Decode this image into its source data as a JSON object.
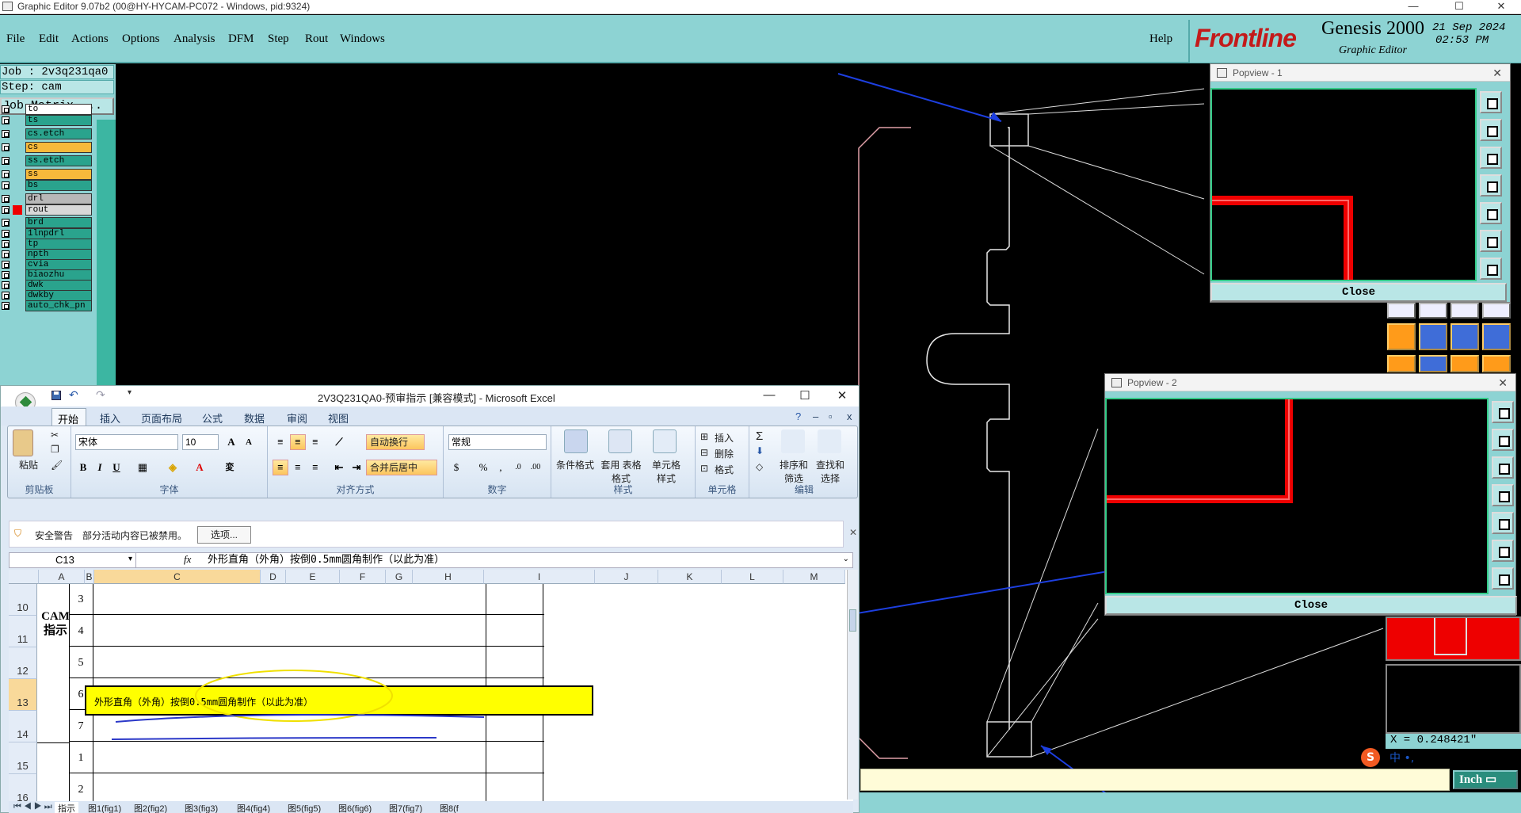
{
  "genesis": {
    "window_title": "Graphic Editor 9.07b2 (00@HY-HYCAM-PC072 - Windows, pid:9324)",
    "window_controls": [
      "—",
      "☐",
      "✕"
    ],
    "menu": [
      {
        "label": "File"
      },
      {
        "label": "Edit"
      },
      {
        "label": "Actions"
      },
      {
        "label": "Options"
      },
      {
        "label": "Analysis"
      },
      {
        "label": "DFM"
      },
      {
        "label": "Step"
      },
      {
        "label": "Rout"
      },
      {
        "label": "Windows"
      }
    ],
    "help_label": "Help",
    "brand": "Frontline",
    "product": "Genesis 2000",
    "subtitle": "Graphic Editor",
    "date": "21 Sep 2024",
    "time": "02:53 PM",
    "job": "Job : 2v3q231qa0",
    "step": "Step: cam",
    "job_matrix": "Job Matrix ...",
    "layers": [
      {
        "name": "to",
        "color": "#ffffff"
      },
      {
        "name": "ts",
        "color": "#2aa38d"
      },
      {
        "name": "cs.etch",
        "color": "#2aa38d"
      },
      {
        "name": "cs",
        "color": "#f6b93b"
      },
      {
        "name": "ss.etch",
        "color": "#2aa38d"
      },
      {
        "name": "ss",
        "color": "#f6b93b"
      },
      {
        "name": "bs",
        "color": "#2aa38d"
      },
      {
        "name": "drl",
        "color": "#b8b8b8"
      },
      {
        "name": "rout",
        "color": "#d8d8d8"
      },
      {
        "name": "brd",
        "color": "#2aa38d"
      },
      {
        "name": "1lnpdrl",
        "color": "#2aa38d"
      },
      {
        "name": "tp",
        "color": "#2aa38d"
      },
      {
        "name": "npth",
        "color": "#2aa38d"
      },
      {
        "name": "cvia",
        "color": "#2aa38d"
      },
      {
        "name": "biaozhu",
        "color": "#2aa38d"
      },
      {
        "name": "dwk",
        "color": "#2aa38d"
      },
      {
        "name": "dwkby",
        "color": "#2aa38d"
      },
      {
        "name": "auto_chk_pn",
        "color": "#2aa38d"
      }
    ],
    "popview1": {
      "title": "Popview - 1",
      "close": "Close"
    },
    "popview2": {
      "title": "Popview - 2",
      "close": "Close"
    },
    "coord_readout": "X = 0.248421\"",
    "units": "Inch",
    "ime_label": "中 •,"
  },
  "excel": {
    "title": "2V3Q231QA0-预审指示 [兼容模式] - Microsoft Excel",
    "tabs": [
      "开始",
      "插入",
      "页面布局",
      "公式",
      "数据",
      "审阅",
      "视图"
    ],
    "ribbon": {
      "paste": "粘贴",
      "clipboard_group": "剪贴板",
      "font_name": "宋体",
      "font_size": "10",
      "font_group": "字体",
      "wrap_text": "自动换行",
      "merge_center": "合并后居中",
      "align_group": "对齐方式",
      "number_format": "常规",
      "number_group": "数字",
      "cond_format": "条件格式",
      "table_format": "套用 表格格式",
      "cell_style": "单元格 样式",
      "styles_group": "样式",
      "insert": "插入",
      "delete": "删除",
      "format": "格式",
      "cells_group": "单元格",
      "sort_filter": "排序和 筛选",
      "find_select": "查找和 选择",
      "edit_group": "编辑"
    },
    "security": {
      "label": "安全警告",
      "message": "部分活动内容已被禁用。",
      "options": "选项..."
    },
    "namebox": "C13",
    "formula": "外形直角（外角）按倒0.5mm圆角制作（以此为准）",
    "columns": [
      "A",
      "B",
      "C",
      "D",
      "E",
      "F",
      "G",
      "H",
      "I",
      "J",
      "K",
      "L",
      "M"
    ],
    "rows": [
      "10",
      "11",
      "12",
      "13",
      "14",
      "15",
      "16"
    ],
    "merged_label": "CAM指示",
    "b_values": [
      "3",
      "4",
      "5",
      "6",
      "7",
      "1",
      "2"
    ],
    "c13_text": "外形直角（外角）按倒0.5mm圆角制作（以此为准）",
    "sheet_tabs": [
      "指示",
      "图1(fig1)",
      "图2(fig2)",
      "图3(fig3)",
      "图4(fig4)",
      "图5(fig5)",
      "图6(fig6)",
      "图7(fig7)",
      "图8(f"
    ]
  }
}
